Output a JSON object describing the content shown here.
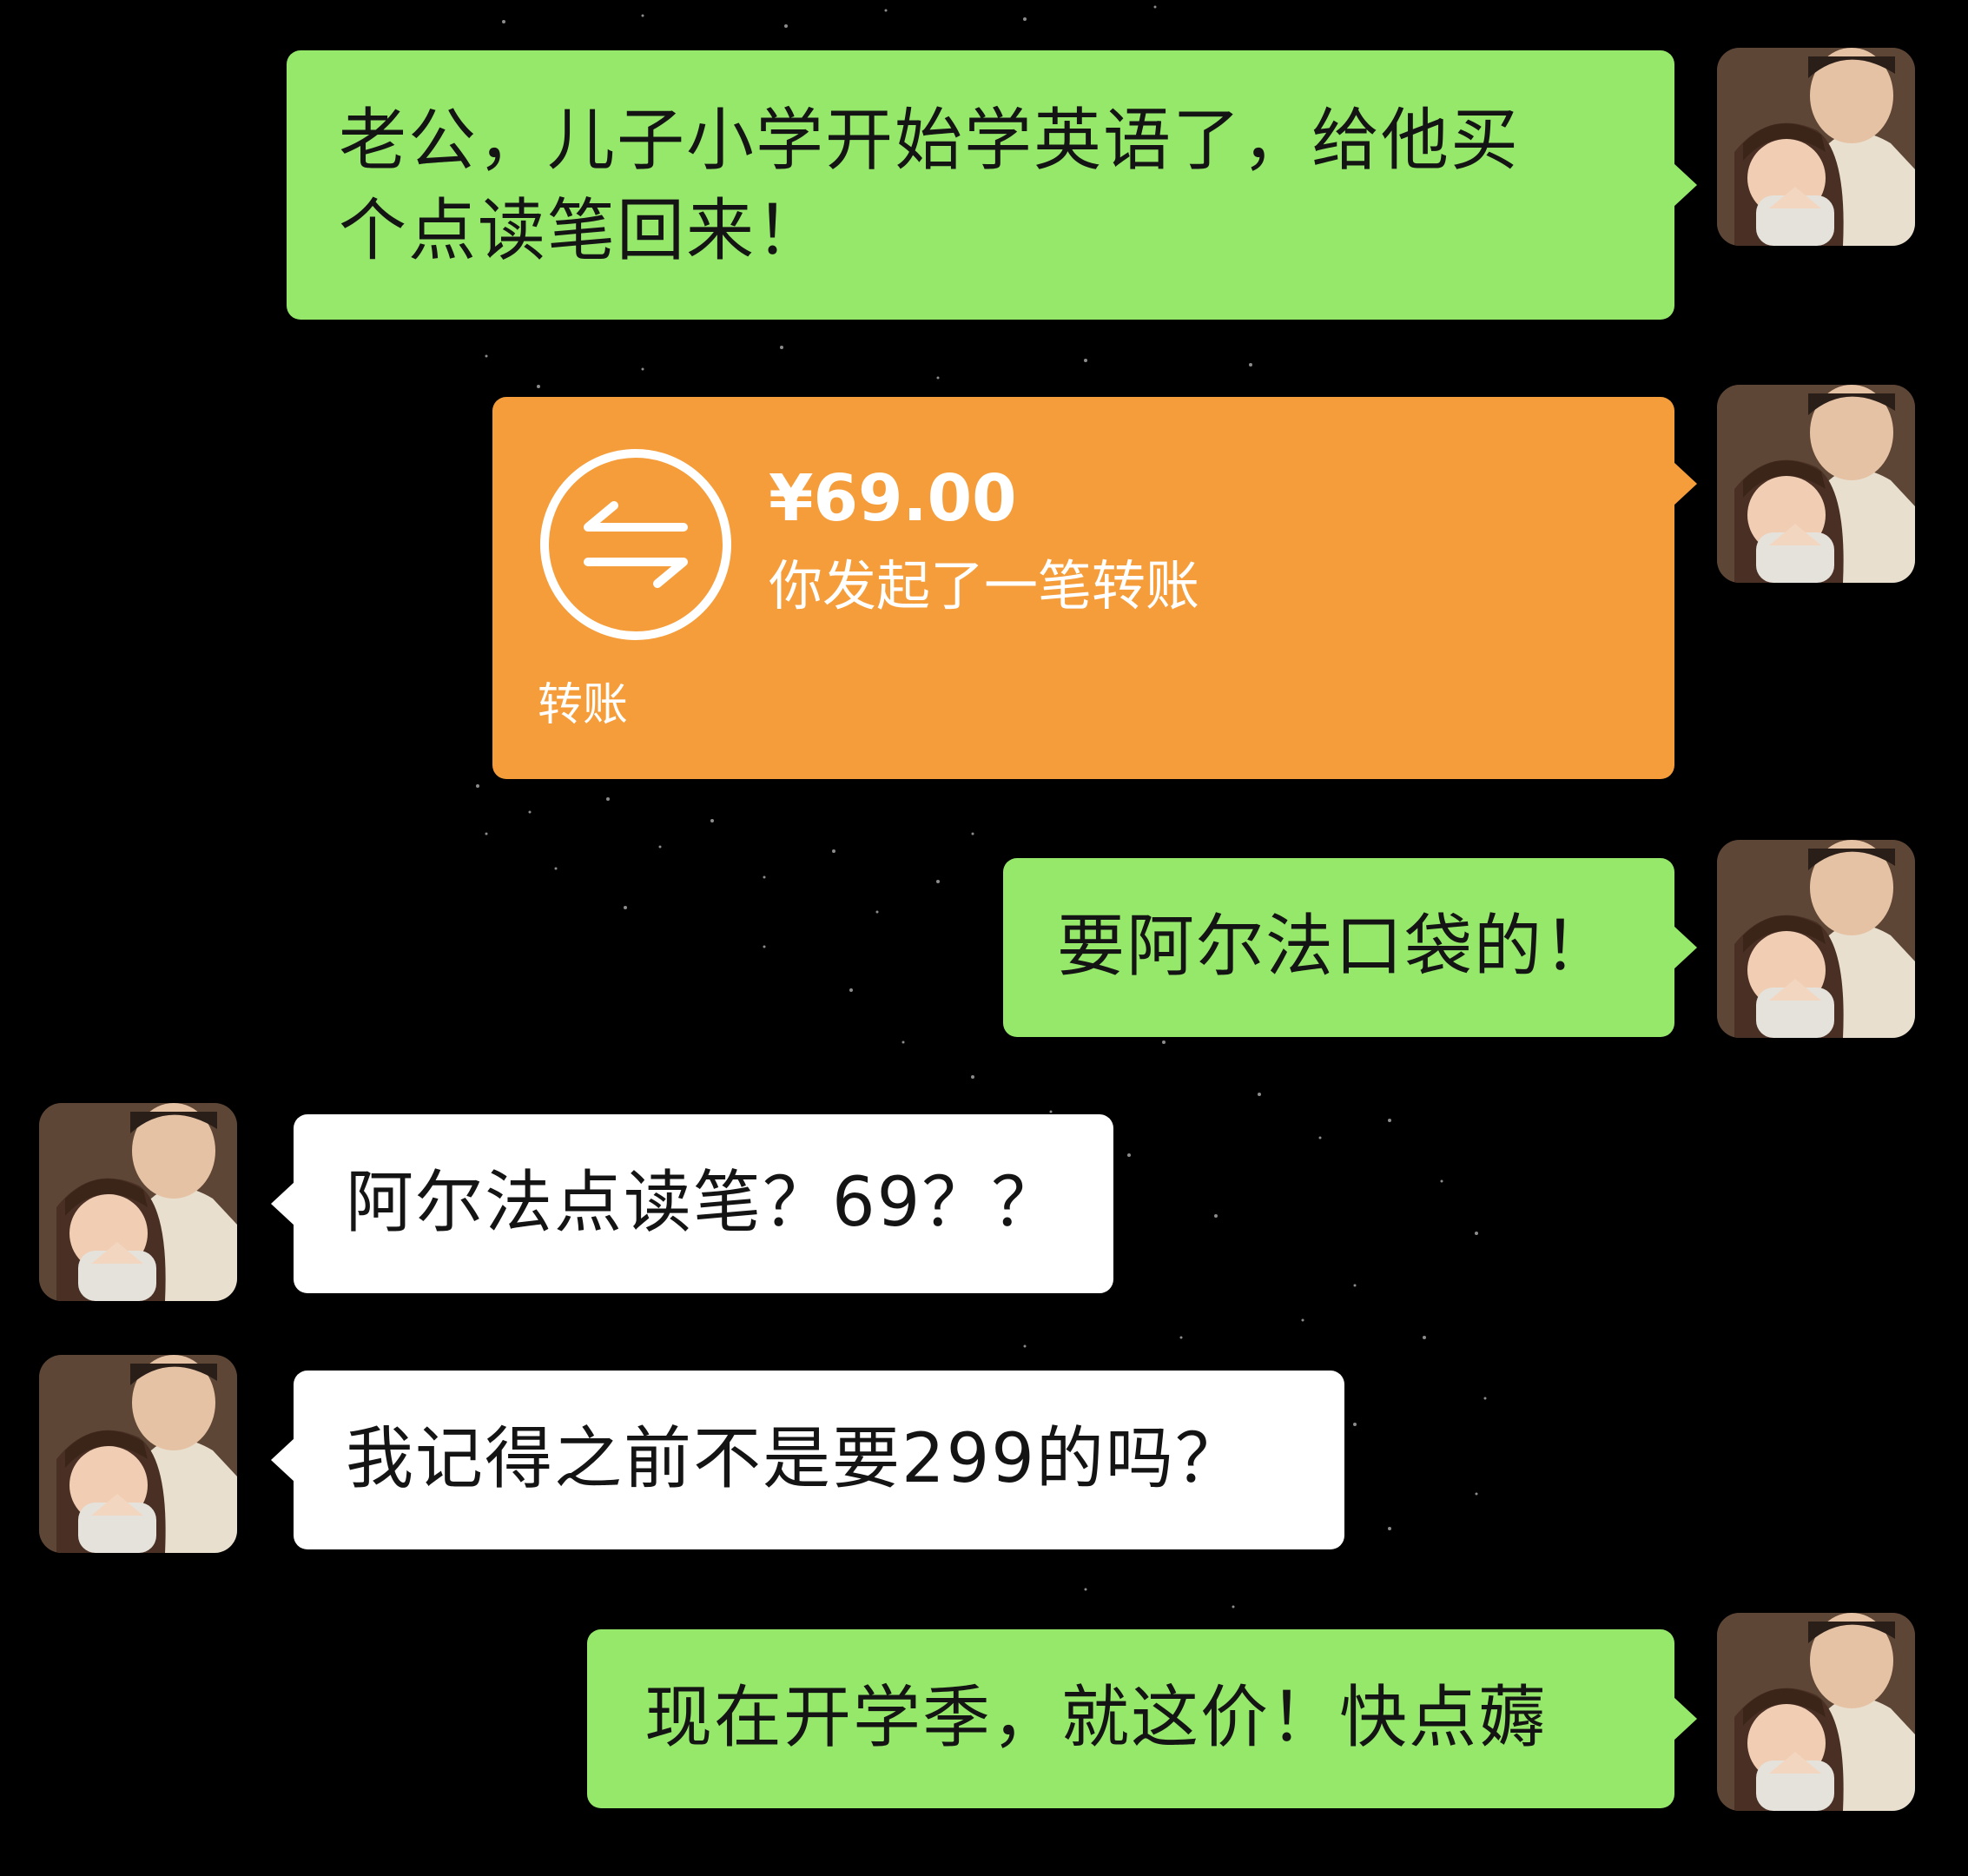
{
  "chat": {
    "messages": [
      {
        "side": "right",
        "type": "text",
        "text": "老公，儿子小学开始学英语了，给他买\n个点读笔回来！"
      },
      {
        "side": "right",
        "type": "transfer",
        "amount": "¥69.00",
        "description": "你发起了一笔转账",
        "label": "转账"
      },
      {
        "side": "right",
        "type": "text",
        "text": "要阿尔法口袋的！"
      },
      {
        "side": "left",
        "type": "text",
        "text": "阿尔法点读笔？69？？"
      },
      {
        "side": "left",
        "type": "text",
        "text": "我记得之前不是要299的吗？"
      },
      {
        "side": "right",
        "type": "text",
        "text": "现在开学季，就这价！快点薅"
      }
    ]
  },
  "colors": {
    "background": "#000000",
    "sent_bubble": "#95e86a",
    "received_bubble": "#ffffff",
    "transfer_bubble": "#f59d3a"
  },
  "icons": {
    "avatar": "avatar-couple-photo",
    "transfer": "transfer-arrows-icon"
  }
}
